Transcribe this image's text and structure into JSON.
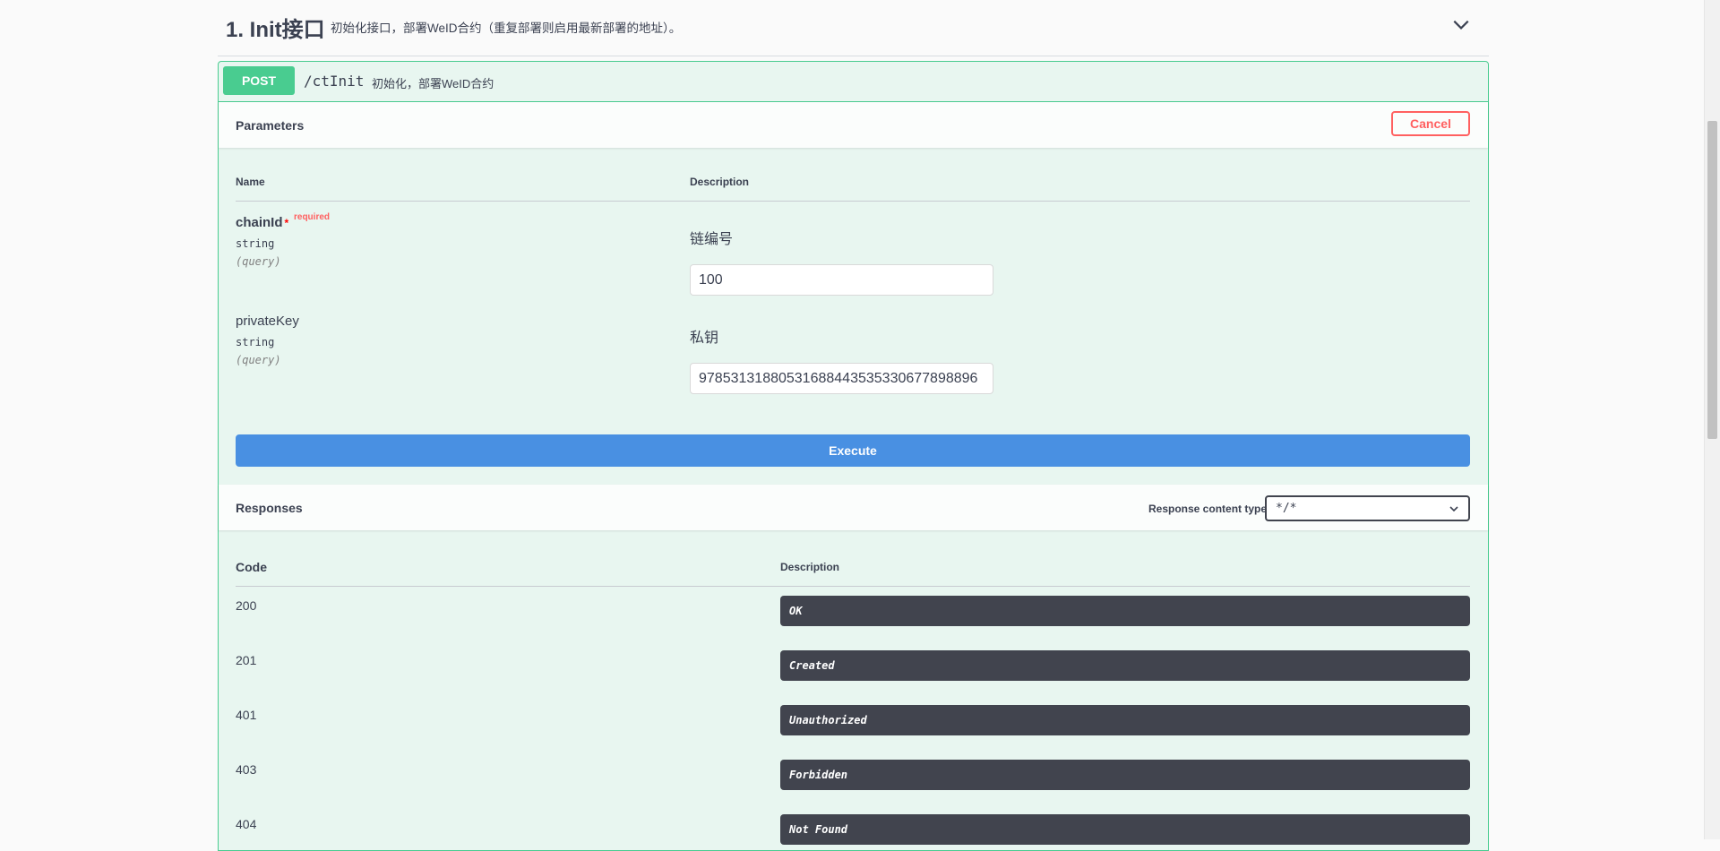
{
  "tag": {
    "title": "1. Init接口",
    "description": "初始化接口，部署WeID合约（重复部署则启用最新部署的地址）。"
  },
  "operation": {
    "method": "POST",
    "path": "/ctInit",
    "summary": "初始化，部署WeID合约"
  },
  "parameters": {
    "section_label": "Parameters",
    "cancel_label": "Cancel",
    "name_header": "Name",
    "description_header": "Description",
    "items": [
      {
        "name": "chainId",
        "required_mark": "*",
        "required_text": "required",
        "type": "string",
        "in": "(query)",
        "description": "链编号",
        "value": "100"
      },
      {
        "name": "privateKey",
        "type": "string",
        "in": "(query)",
        "description": "私钥",
        "value": "97853131880531688443535330677898896"
      }
    ]
  },
  "execute_label": "Execute",
  "responses": {
    "section_label": "Responses",
    "content_type_label": "Response content type",
    "content_type_value": "*/*",
    "code_header": "Code",
    "description_header": "Description",
    "rows": [
      {
        "code": "200",
        "description": "OK"
      },
      {
        "code": "201",
        "description": "Created"
      },
      {
        "code": "401",
        "description": "Unauthorized"
      },
      {
        "code": "403",
        "description": "Forbidden"
      },
      {
        "code": "404",
        "description": "Not Found"
      }
    ]
  },
  "icons": {
    "tag_toggle": "chevron-down-icon",
    "select_arrow": "chevron-down-icon"
  },
  "colors": {
    "post": "#49cc90",
    "post_bg": "#e8f6f0",
    "execute": "#4990e2",
    "cancel": "#ff6060",
    "response_box": "#41444e"
  }
}
